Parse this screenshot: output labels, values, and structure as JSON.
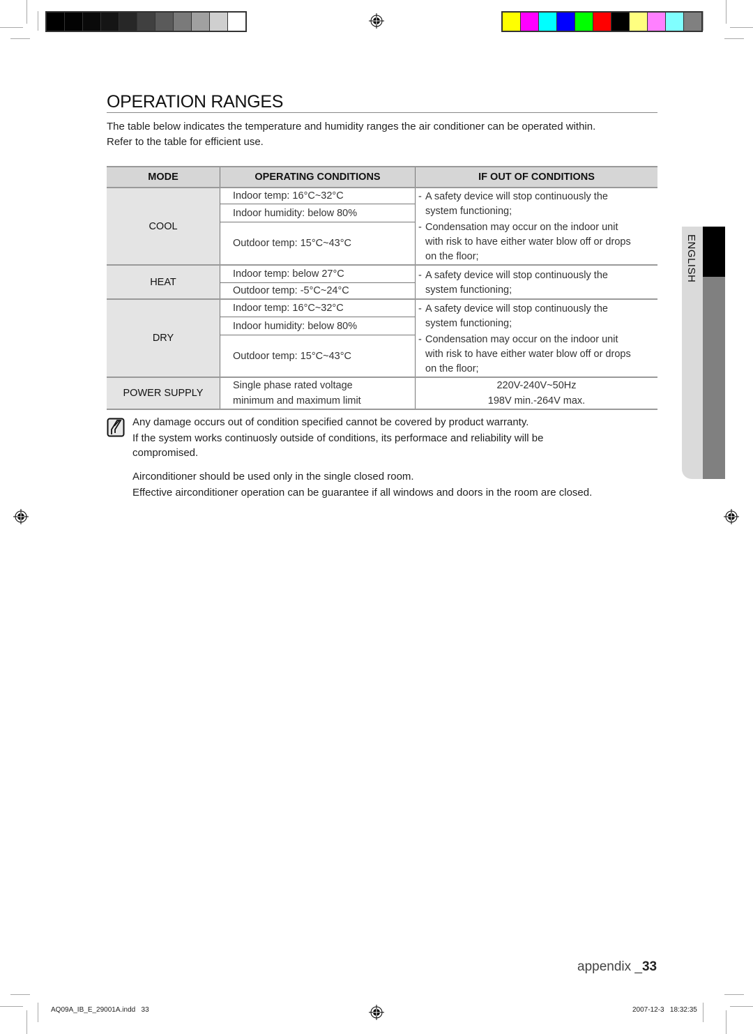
{
  "print_marks": {
    "grayscale_bar": [
      "#000000",
      "#030303",
      "#0a0a0a",
      "#151515",
      "#272727",
      "#404040",
      "#5a5a5a",
      "#7a7a7a",
      "#a0a0a0",
      "#cfcfcf",
      "#ffffff"
    ],
    "color_bar": [
      "#ffff00",
      "#ff00ff",
      "#00ffff",
      "#0000ff",
      "#00ff00",
      "#ff0000",
      "#000000",
      "#ffff80",
      "#ff80ff",
      "#80ffff",
      "#808080"
    ]
  },
  "page": {
    "title": "OPERATION RANGES",
    "intro_line1": "The table below indicates the temperature and humidity ranges the air conditioner can be operated within.",
    "intro_line2": "Refer to the table for efficient use."
  },
  "table": {
    "headers": {
      "mode": "MODE",
      "operating_conditions": "OPERATING CONDITIONS",
      "if_out": "IF OUT OF CONDITIONS"
    },
    "rows": [
      {
        "mode": "COOL",
        "conditions": [
          "Indoor temp: 16°C~32°C",
          "Indoor humidity: below 80%",
          "Outdoor temp: 15°C~43°C"
        ],
        "consequences": [
          [
            "A safety device will stop continuously the",
            "system functioning;"
          ],
          [
            "Condensation may occur on the indoor unit",
            "with risk to have either water blow off or drops",
            "on the floor;"
          ]
        ]
      },
      {
        "mode": "HEAT",
        "conditions": [
          "Indoor temp: below 27°C",
          "Outdoor temp: -5°C~24°C"
        ],
        "consequences": [
          [
            "A safety device will stop continuously the",
            "system functioning;"
          ]
        ]
      },
      {
        "mode": "DRY",
        "conditions": [
          "Indoor temp: 16°C~32°C",
          "Indoor humidity: below 80%",
          "Outdoor temp: 15°C~43°C"
        ],
        "consequences": [
          [
            "A safety device will stop continuously the",
            "system functioning;"
          ],
          [
            "Condensation may occur on the indoor unit",
            "with risk to have either water blow off or drops",
            "on the floor;"
          ]
        ]
      },
      {
        "mode": "POWER SUPPLY",
        "conditions": [
          "Single phase rated voltage",
          "minimum and maximum limit"
        ],
        "values": [
          "220V-240V~50Hz",
          "198V min.-264V max."
        ]
      }
    ]
  },
  "notes": {
    "line1": "Any damage occurs out of condition specified cannot be covered by product warranty.",
    "line2": "If the system works continuosly outside of conditions, its performace and reliability will be",
    "line3": "compromised.",
    "line4": "Airconditioner should be used only in the single closed room.",
    "line5": "Effective airconditioner operation can be guarantee if all windows and doors in the room are closed."
  },
  "side_tab": {
    "label": "ENGLISH"
  },
  "footer": {
    "section": "appendix _",
    "page_number": "33",
    "slug_file": "AQ09A_IB_E_29001A.indd   33",
    "slug_timestamp": "2007-12-3   18:32:35"
  }
}
